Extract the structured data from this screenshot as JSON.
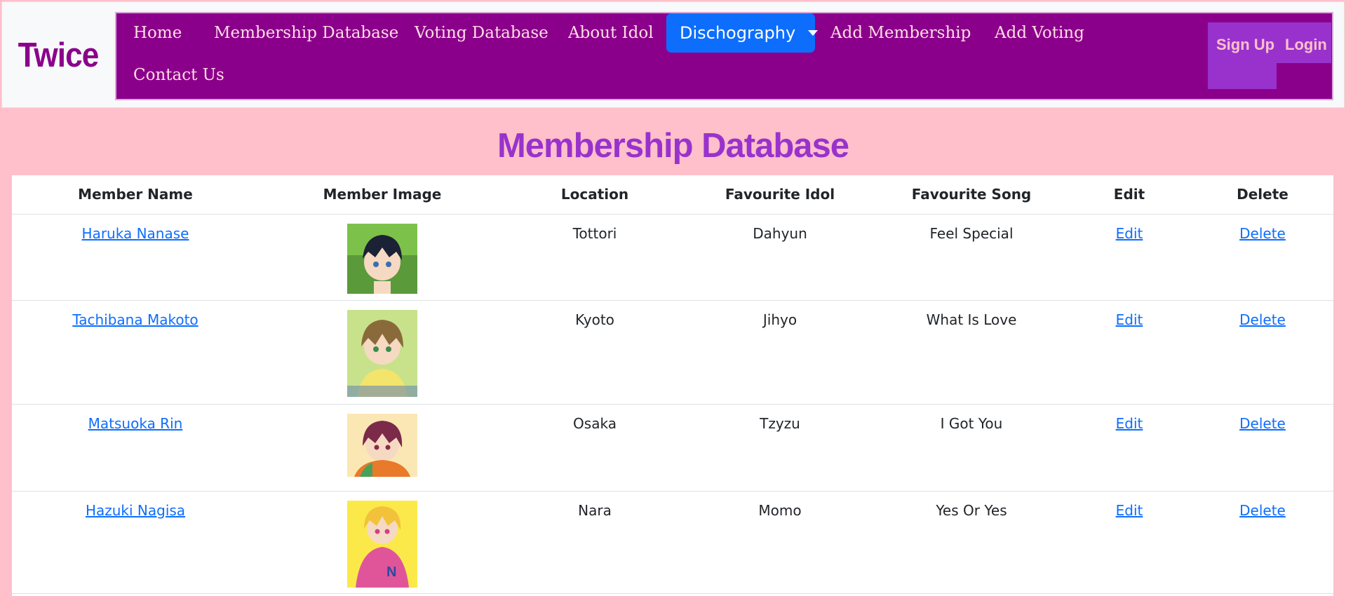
{
  "brand": "Twice",
  "nav": {
    "items": [
      "Home",
      "Membership Database",
      "Voting Database",
      "About Idol"
    ],
    "dropdown": "Dischography",
    "items_after": [
      "Add Membership",
      "Add Voting"
    ],
    "second_row": "Contact Us",
    "signup": "Sign Up",
    "login": "Login"
  },
  "page_title": "Membership Database",
  "table": {
    "headers": [
      "Member Name",
      "Member Image",
      "Location",
      "Favourite Idol",
      "Favourite Song",
      "Edit",
      "Delete"
    ],
    "rows": [
      {
        "name": "Haruka Nanase",
        "image": "avatar-haruka",
        "location": "Tottori",
        "idol": "Dahyun",
        "song": "Feel Special",
        "edit": "Edit",
        "delete": "Delete"
      },
      {
        "name": "Tachibana Makoto",
        "image": "avatar-makoto",
        "location": "Kyoto",
        "idol": "Jihyo",
        "song": "What Is Love",
        "edit": "Edit",
        "delete": "Delete"
      },
      {
        "name": "Matsuoka Rin",
        "image": "avatar-rin",
        "location": "Osaka",
        "idol": "Tzyzu",
        "song": "I Got You",
        "edit": "Edit",
        "delete": "Delete"
      },
      {
        "name": "Hazuki Nagisa",
        "image": "avatar-nagisa",
        "location": "Nara",
        "idol": "Momo",
        "song": "Yes Or Yes",
        "edit": "Edit",
        "delete": "Delete"
      }
    ]
  },
  "colors": {
    "background": "#ffc0cb",
    "nav": "#8b008b",
    "accent": "#9932cc",
    "active": "#0d6efd",
    "link": "#0d6efd"
  }
}
